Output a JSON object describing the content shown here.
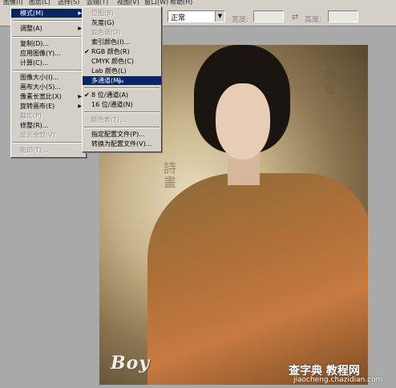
{
  "menubar": {
    "items": [
      "图像(I)",
      "图层(L)",
      "选择(S)",
      "滤镜(T)",
      "视图(V)",
      "窗口(W)",
      "帮助(H)"
    ]
  },
  "options_bar": {
    "mode_value": "正常",
    "width_label": "宽度:",
    "height_label": "高度:"
  },
  "image_menu": {
    "items": [
      {
        "label": "模式(M)",
        "submenu": true,
        "highlighted": true
      },
      {
        "label": "调整(A)",
        "submenu": true
      },
      {
        "label": "复制(D)..."
      },
      {
        "label": "应用图像(Y)..."
      },
      {
        "label": "计算(C)..."
      },
      {
        "label": "图像大小(I)..."
      },
      {
        "label": "画布大小(S)..."
      },
      {
        "label": "像素长宽比(X)",
        "submenu": true
      },
      {
        "label": "旋转画布(E)",
        "submenu": true
      },
      {
        "label": "裁切(P)",
        "disabled": true
      },
      {
        "label": "修整(R)..."
      },
      {
        "label": "显示全部(V)",
        "disabled": true
      },
      {
        "label": "陷印(T)...",
        "disabled": true
      }
    ]
  },
  "mode_menu": {
    "items": [
      {
        "label": "位图(B)",
        "disabled": true
      },
      {
        "label": "灰度(G)"
      },
      {
        "label": "双色调(D)",
        "disabled": true
      },
      {
        "label": "索引颜色(I)..."
      },
      {
        "label": "RGB 颜色(R)",
        "checked": true
      },
      {
        "label": "CMYK 颜色(C)"
      },
      {
        "label": "Lab 颜色(L)"
      },
      {
        "label": "多通道(M)",
        "highlighted": true
      },
      {
        "label": "8 位/通道(A)",
        "checked": true
      },
      {
        "label": "16 位/通道(N)"
      },
      {
        "label": "颜色表(T)...",
        "disabled": true
      },
      {
        "label": "指定配置文件(P)..."
      },
      {
        "label": "转换为配置文件(V)..."
      }
    ]
  },
  "document": {
    "signature": "Boy",
    "watermark_title": "查字典 教程网",
    "watermark_url": "jiaocheng.chazidian.com"
  },
  "colors": {
    "menu_bg": "#d4d0c8",
    "highlight": "#0a246a",
    "workspace": "#a9a9a9"
  }
}
